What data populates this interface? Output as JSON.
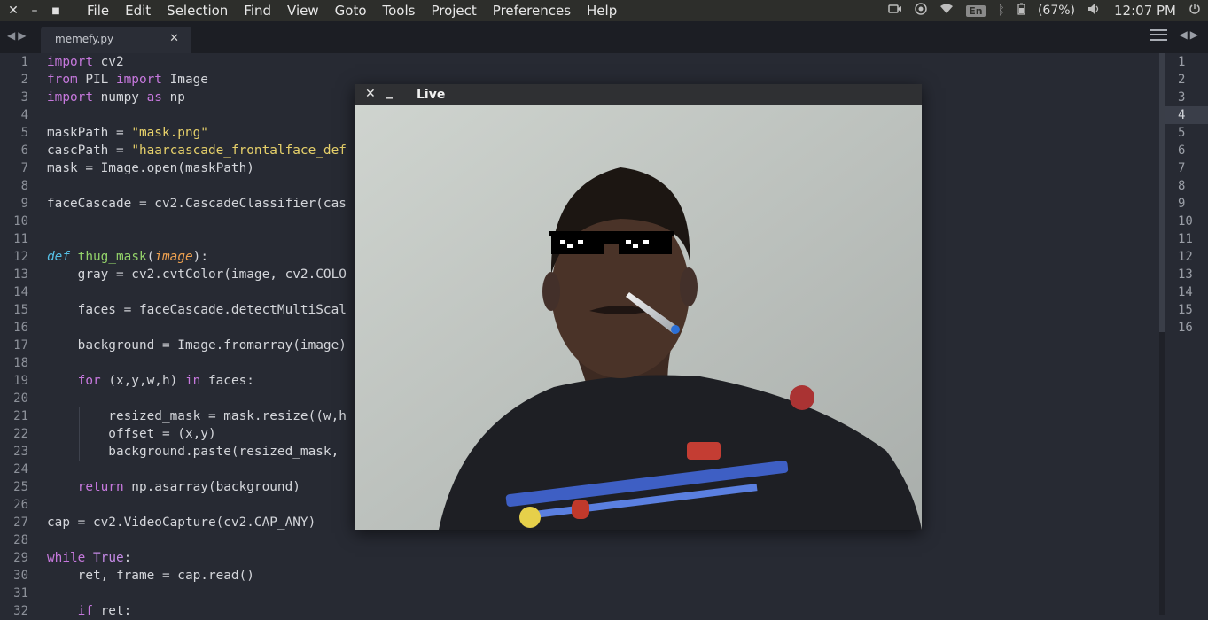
{
  "menubar": {
    "menus": [
      "File",
      "Edit",
      "Selection",
      "Find",
      "View",
      "Goto",
      "Tools",
      "Project",
      "Preferences",
      "Help"
    ],
    "tray": {
      "keyboard": "En",
      "battery": "(67%)",
      "time": "12:07 PM"
    }
  },
  "tab": {
    "title": "memefy.py"
  },
  "editor": {
    "line_numbers": [
      1,
      2,
      3,
      4,
      5,
      6,
      7,
      8,
      9,
      10,
      11,
      12,
      13,
      14,
      15,
      16,
      17,
      18,
      19,
      20,
      21,
      22,
      23,
      24,
      25,
      26,
      27,
      28,
      29,
      30,
      31,
      32
    ],
    "lines": [
      "import cv2",
      "from PIL import Image",
      "import numpy as np",
      "",
      "maskPath = \"mask.png\"",
      "cascPath = \"haarcascade_frontalface_def",
      "mask = Image.open(maskPath)",
      "",
      "faceCascade = cv2.CascadeClassifier(cas",
      "",
      "",
      "def thug_mask(image):",
      "    gray = cv2.cvtColor(image, cv2.COLO",
      "",
      "    faces = faceCascade.detectMultiScal",
      "",
      "    background = Image.fromarray(image)",
      "",
      "    for (x,y,w,h) in faces:",
      "",
      "        resized_mask = mask.resize((w,h",
      "        offset = (x,y)",
      "        background.paste(resized_mask,",
      "",
      "    return np.asarray(background)",
      "",
      "cap = cv2.VideoCapture(cv2.CAP_ANY)",
      "",
      "while True:",
      "    ret, frame = cap.read()",
      "",
      "    if ret:"
    ]
  },
  "minimap": {
    "line_numbers": [
      1,
      2,
      3,
      4,
      5,
      6,
      7,
      8,
      9,
      10,
      11,
      12,
      13,
      14,
      15,
      16
    ],
    "active_line": 4
  },
  "live_window": {
    "title": "Live"
  }
}
